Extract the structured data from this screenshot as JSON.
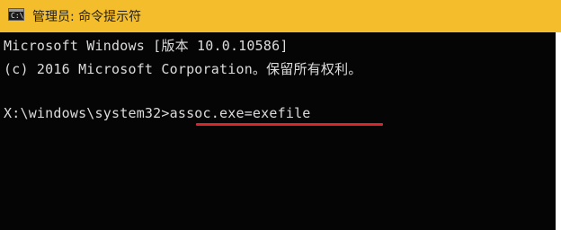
{
  "window": {
    "title": "管理员: 命令提示符",
    "icon": "cmd-window-icon",
    "icon_glyph": "C:\\"
  },
  "console": {
    "lines": [
      "Microsoft Windows [版本 10.0.10586]",
      "(c) 2016 Microsoft Corporation。保留所有权利。",
      "X:\\windows\\system32>assoc.exe=exefile"
    ],
    "colors": {
      "background": "#050505",
      "text": "#dcdcdc",
      "titlebar": "#f3bd2c",
      "annotation_underline": "#d8262c"
    }
  }
}
